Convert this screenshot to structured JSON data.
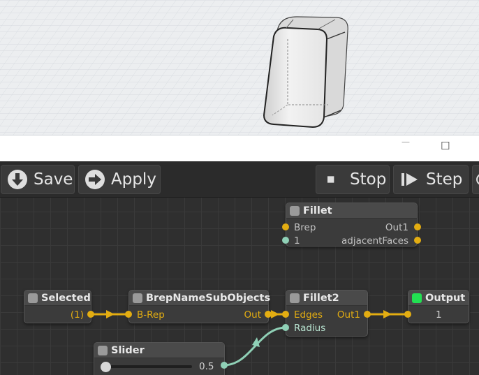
{
  "toolbar": {
    "save_label": "Save",
    "apply_label": "Apply",
    "stop_label": "Stop",
    "step_label": "Step"
  },
  "window": {
    "minimize_glyph": "—",
    "maximize_glyph": "☐"
  },
  "nodes": {
    "fillet": {
      "title": "Fillet",
      "in1": "Brep",
      "in2": "1",
      "out1": "Out1",
      "out2": "adjacentFaces"
    },
    "selected": {
      "title": "Selected",
      "out1": "(1)"
    },
    "brepname": {
      "title": "BrepNameSubObjects",
      "in1": "B-Rep",
      "out1": "Out"
    },
    "fillet2": {
      "title": "Fillet2",
      "in1": "Edges",
      "in2": "Radius",
      "out1": "Out1"
    },
    "output": {
      "title": "Output",
      "value": "1"
    },
    "slider": {
      "title": "Slider",
      "value": "0.5",
      "fraction": 0.0
    }
  },
  "colors": {
    "wire": "#e3ad12",
    "wire_float": "#8fd0b6",
    "output_status": "#22e052"
  },
  "icons": {
    "save": "download-circle-icon",
    "apply": "arrow-right-circle-icon",
    "stop": "stop-square-icon",
    "step": "step-forward-icon"
  }
}
